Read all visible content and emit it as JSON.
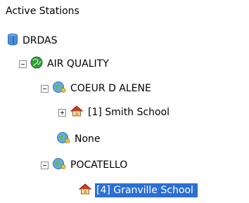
{
  "panel": {
    "title": "Active Stations"
  },
  "tree": {
    "root": {
      "label": "DRDAS",
      "icon": "database-icon"
    },
    "group": {
      "label": "AIR QUALITY",
      "icon": "globe-icon",
      "expanded": true
    },
    "coeur": {
      "label": "COEUR D ALENE",
      "icon": "network-globe-icon",
      "expanded": true
    },
    "smith": {
      "label": "[1] Smith School",
      "icon": "house-icon",
      "expanded": false
    },
    "none": {
      "label": "None",
      "icon": "network-globe-icon"
    },
    "pocatello": {
      "label": "POCATELLO",
      "icon": "network-globe-icon",
      "expanded": true
    },
    "granville": {
      "label": "[4] Granville School",
      "icon": "house-icon",
      "selected": true
    }
  },
  "colors": {
    "selection": "#2a6fd6",
    "globe_green": "#2f9e3a",
    "house_red": "#d23a1f"
  }
}
